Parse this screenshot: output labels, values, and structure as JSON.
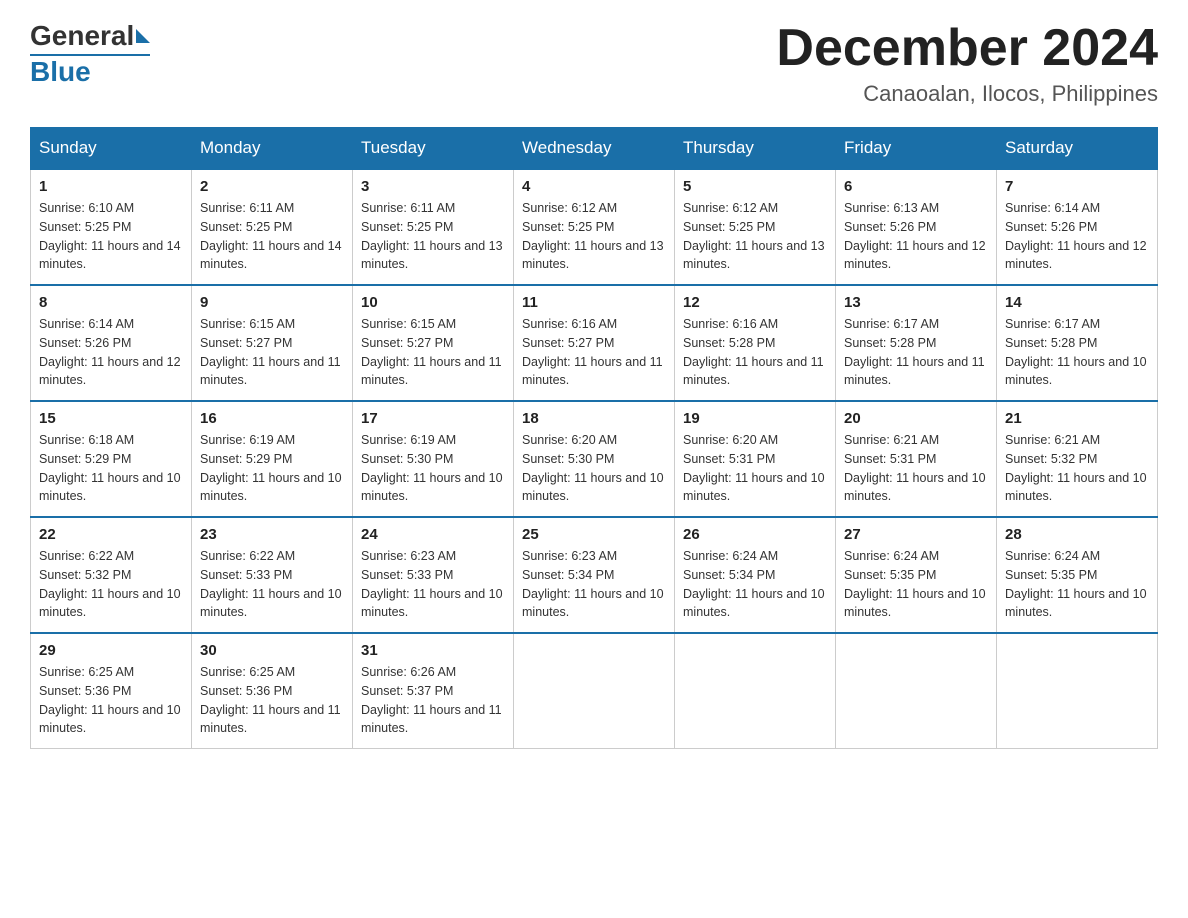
{
  "header": {
    "logo_general": "General",
    "logo_blue": "Blue",
    "month_year": "December 2024",
    "location": "Canaoalan, Ilocos, Philippines"
  },
  "weekdays": [
    "Sunday",
    "Monday",
    "Tuesday",
    "Wednesday",
    "Thursday",
    "Friday",
    "Saturday"
  ],
  "weeks": [
    [
      {
        "day": "1",
        "sunrise": "6:10 AM",
        "sunset": "5:25 PM",
        "daylight": "11 hours and 14 minutes."
      },
      {
        "day": "2",
        "sunrise": "6:11 AM",
        "sunset": "5:25 PM",
        "daylight": "11 hours and 14 minutes."
      },
      {
        "day": "3",
        "sunrise": "6:11 AM",
        "sunset": "5:25 PM",
        "daylight": "11 hours and 13 minutes."
      },
      {
        "day": "4",
        "sunrise": "6:12 AM",
        "sunset": "5:25 PM",
        "daylight": "11 hours and 13 minutes."
      },
      {
        "day": "5",
        "sunrise": "6:12 AM",
        "sunset": "5:25 PM",
        "daylight": "11 hours and 13 minutes."
      },
      {
        "day": "6",
        "sunrise": "6:13 AM",
        "sunset": "5:26 PM",
        "daylight": "11 hours and 12 minutes."
      },
      {
        "day": "7",
        "sunrise": "6:14 AM",
        "sunset": "5:26 PM",
        "daylight": "11 hours and 12 minutes."
      }
    ],
    [
      {
        "day": "8",
        "sunrise": "6:14 AM",
        "sunset": "5:26 PM",
        "daylight": "11 hours and 12 minutes."
      },
      {
        "day": "9",
        "sunrise": "6:15 AM",
        "sunset": "5:27 PM",
        "daylight": "11 hours and 11 minutes."
      },
      {
        "day": "10",
        "sunrise": "6:15 AM",
        "sunset": "5:27 PM",
        "daylight": "11 hours and 11 minutes."
      },
      {
        "day": "11",
        "sunrise": "6:16 AM",
        "sunset": "5:27 PM",
        "daylight": "11 hours and 11 minutes."
      },
      {
        "day": "12",
        "sunrise": "6:16 AM",
        "sunset": "5:28 PM",
        "daylight": "11 hours and 11 minutes."
      },
      {
        "day": "13",
        "sunrise": "6:17 AM",
        "sunset": "5:28 PM",
        "daylight": "11 hours and 11 minutes."
      },
      {
        "day": "14",
        "sunrise": "6:17 AM",
        "sunset": "5:28 PM",
        "daylight": "11 hours and 10 minutes."
      }
    ],
    [
      {
        "day": "15",
        "sunrise": "6:18 AM",
        "sunset": "5:29 PM",
        "daylight": "11 hours and 10 minutes."
      },
      {
        "day": "16",
        "sunrise": "6:19 AM",
        "sunset": "5:29 PM",
        "daylight": "11 hours and 10 minutes."
      },
      {
        "day": "17",
        "sunrise": "6:19 AM",
        "sunset": "5:30 PM",
        "daylight": "11 hours and 10 minutes."
      },
      {
        "day": "18",
        "sunrise": "6:20 AM",
        "sunset": "5:30 PM",
        "daylight": "11 hours and 10 minutes."
      },
      {
        "day": "19",
        "sunrise": "6:20 AM",
        "sunset": "5:31 PM",
        "daylight": "11 hours and 10 minutes."
      },
      {
        "day": "20",
        "sunrise": "6:21 AM",
        "sunset": "5:31 PM",
        "daylight": "11 hours and 10 minutes."
      },
      {
        "day": "21",
        "sunrise": "6:21 AM",
        "sunset": "5:32 PM",
        "daylight": "11 hours and 10 minutes."
      }
    ],
    [
      {
        "day": "22",
        "sunrise": "6:22 AM",
        "sunset": "5:32 PM",
        "daylight": "11 hours and 10 minutes."
      },
      {
        "day": "23",
        "sunrise": "6:22 AM",
        "sunset": "5:33 PM",
        "daylight": "11 hours and 10 minutes."
      },
      {
        "day": "24",
        "sunrise": "6:23 AM",
        "sunset": "5:33 PM",
        "daylight": "11 hours and 10 minutes."
      },
      {
        "day": "25",
        "sunrise": "6:23 AM",
        "sunset": "5:34 PM",
        "daylight": "11 hours and 10 minutes."
      },
      {
        "day": "26",
        "sunrise": "6:24 AM",
        "sunset": "5:34 PM",
        "daylight": "11 hours and 10 minutes."
      },
      {
        "day": "27",
        "sunrise": "6:24 AM",
        "sunset": "5:35 PM",
        "daylight": "11 hours and 10 minutes."
      },
      {
        "day": "28",
        "sunrise": "6:24 AM",
        "sunset": "5:35 PM",
        "daylight": "11 hours and 10 minutes."
      }
    ],
    [
      {
        "day": "29",
        "sunrise": "6:25 AM",
        "sunset": "5:36 PM",
        "daylight": "11 hours and 10 minutes."
      },
      {
        "day": "30",
        "sunrise": "6:25 AM",
        "sunset": "5:36 PM",
        "daylight": "11 hours and 11 minutes."
      },
      {
        "day": "31",
        "sunrise": "6:26 AM",
        "sunset": "5:37 PM",
        "daylight": "11 hours and 11 minutes."
      },
      null,
      null,
      null,
      null
    ]
  ],
  "labels": {
    "sunrise": "Sunrise:",
    "sunset": "Sunset:",
    "daylight": "Daylight:"
  },
  "colors": {
    "header_bg": "#1a6fa8",
    "border_top": "#1a6fa8"
  }
}
